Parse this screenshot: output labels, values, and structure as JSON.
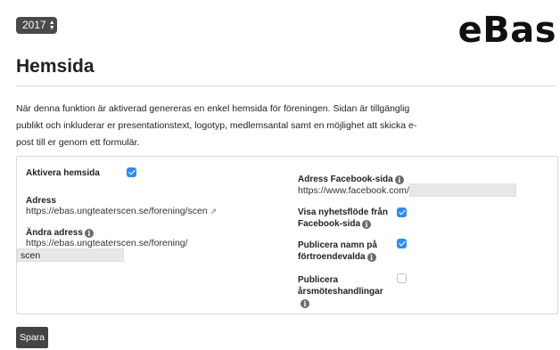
{
  "header": {
    "year_value": "2017",
    "logo_text": "eBas"
  },
  "page": {
    "title": "Hemsida",
    "intro_lines": [
      "När denna funktion är aktiverad genereras en enkel hemsida för föreningen. Sidan är tillgänglig",
      "publikt och inkluderar er presentationstext, logotyp, medlemsantal samt en möjlighet att skicka e-",
      "post till er genom ett formulär."
    ]
  },
  "form": {
    "activate_label": "Aktivera hemsida",
    "activate_checked": true,
    "address_label": "Adress",
    "address_value": "https://ebas.ungteaterscen.se/forening/scen",
    "change_address_label": "Ändra adress",
    "change_address_prefix": "https://ebas.ungteaterscen.se/forening/",
    "change_address_value": "scen",
    "facebook_label": "Adress Facebook-sida",
    "facebook_prefix": "https://www.facebook.com/",
    "facebook_value": "",
    "show_feed_label_1": "Visa nyhetsflöde från",
    "show_feed_label_2": "Facebook-sida",
    "show_feed_checked": true,
    "publish_names_label_1": "Publicera namn på",
    "publish_names_label_2": "förtroendevalda",
    "publish_names_checked": true,
    "publish_docs_label_1": "Publicera",
    "publish_docs_label_2": "årsmöteshandlingar",
    "publish_docs_checked": false
  },
  "actions": {
    "save_label": "Spara"
  },
  "icons": {
    "info": "info-circle-icon",
    "external": "external-link-icon",
    "select_arrows": "updown-chevron-icon"
  },
  "colors": {
    "checkbox_on": "#2f8cf0",
    "button_bg": "#444444",
    "input_bg": "#e8e8e8"
  }
}
